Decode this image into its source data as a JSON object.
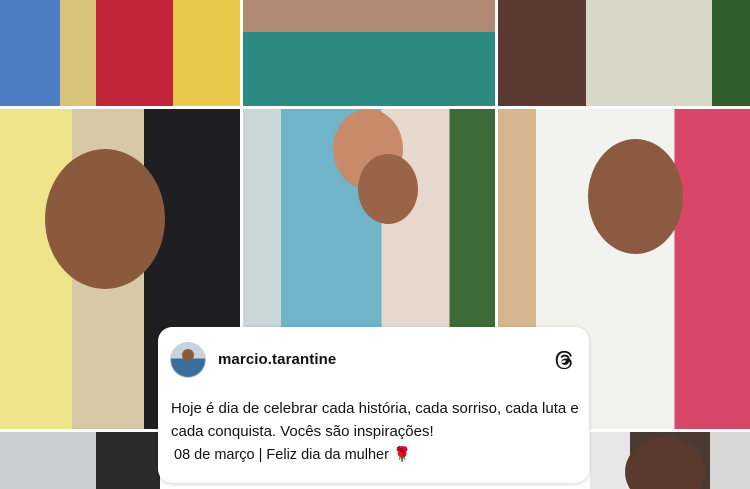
{
  "post": {
    "username": "marcio.tarantine",
    "text": "Hoje é dia de celebrar cada história, cada sorriso, cada luta e cada conquista. Vocês são inspirações!",
    "date_line": "08 de março | Feliz dia da mulher",
    "emoji": "🌹"
  },
  "icons": {
    "avatar": "profile-avatar",
    "brand": "threads-logo-icon"
  }
}
